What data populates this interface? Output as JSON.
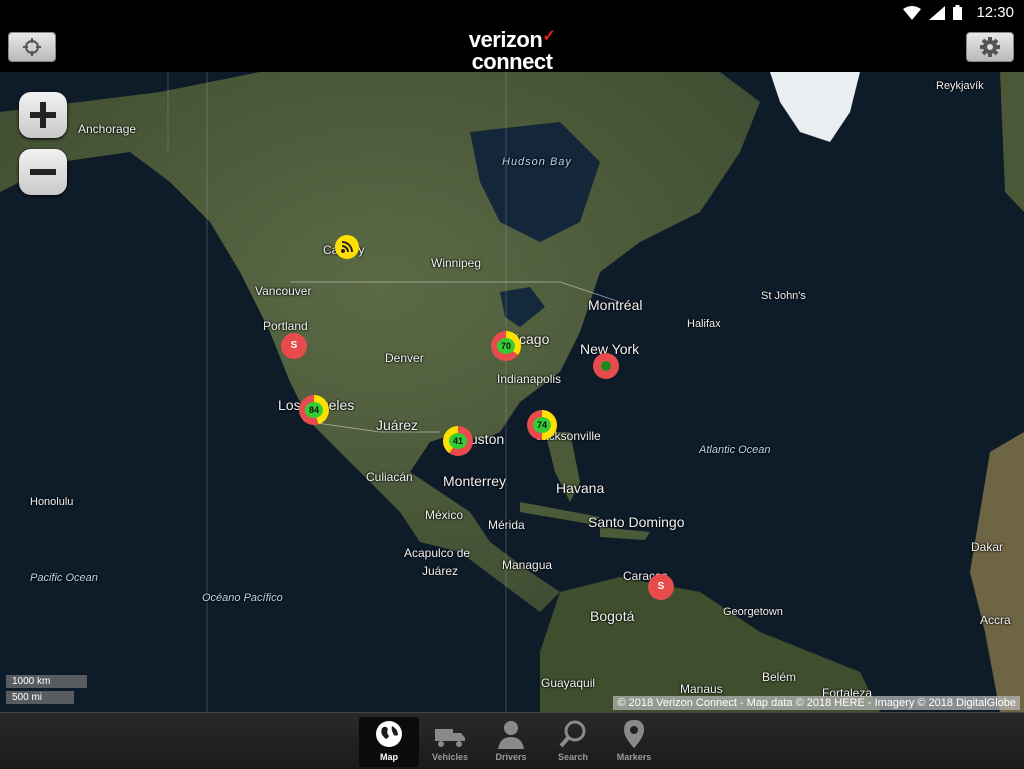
{
  "status": {
    "time": "12:30"
  },
  "header": {
    "logo_line1": "verizon",
    "logo_line2": "connect",
    "logo_check": "✓"
  },
  "zoom": {
    "in_label": "+",
    "out_label": "−"
  },
  "map": {
    "labels": {
      "anchorage": "Anchorage",
      "hudson_bay": "Hudson Bay",
      "calgary": "Calgary",
      "winnipeg": "Winnipeg",
      "vancouver": "Vancouver",
      "portland": "Portland",
      "montreal": "Montréal",
      "st_johns": "St John's",
      "halifax": "Halifax",
      "chicago": "Chicago",
      "new_york": "New York",
      "denver": "Denver",
      "indianapolis": "Indianapolis",
      "los_angeles": "Los Angeles",
      "juarez": "Juárez",
      "houston": "Houston",
      "jacksonville": "Jacksonville",
      "culiacan": "Culiacán",
      "monterrey": "Monterrey",
      "havana": "Havana",
      "atlantic_ocean": "Atlantic Ocean",
      "honolulu": "Honolulu",
      "mexico": "México",
      "merida": "Mérida",
      "santo_domingo": "Santo Domingo",
      "acapulco": "Acapulco de",
      "acapulco2": "Juárez",
      "managua": "Managua",
      "caracas": "Caracas",
      "pacific_ocean": "Pacific Ocean",
      "oceano_pacifico": "Océano Pacífico",
      "georgetown": "Georgetown",
      "bogota": "Bogotá",
      "dakar": "Dakar",
      "accra": "Accra",
      "reykjavik": "Reykjavík",
      "guayaquil": "Guayaquil",
      "manaus": "Manaus",
      "belem": "Belém",
      "fortaleza": "Fortaleza"
    },
    "clusters": [
      {
        "id": "chicago",
        "count": "70"
      },
      {
        "id": "los-angeles",
        "count": "84"
      },
      {
        "id": "houston",
        "count": "41"
      },
      {
        "id": "jacksonville",
        "count": "74"
      }
    ],
    "single_badges": {
      "portland": "S",
      "caracas": "S"
    },
    "scale": {
      "km": "1000 km",
      "mi": "500 mi"
    },
    "attribution": "© 2018 Verizon Connect - Map data © 2018 HERE - Imagery © 2018 DigitalGlobe"
  },
  "tabs": [
    {
      "label": "Map",
      "icon": "globe-icon"
    },
    {
      "label": "Vehicles",
      "icon": "truck-icon"
    },
    {
      "label": "Drivers",
      "icon": "person-icon"
    },
    {
      "label": "Search",
      "icon": "search-icon"
    },
    {
      "label": "Markers",
      "icon": "map-pin-icon"
    }
  ],
  "colors": {
    "brand_red": "#e2231a",
    "cluster_green": "#33cc33",
    "badge_red": "#e84b4b",
    "ring_yellow": "#ffe000"
  }
}
